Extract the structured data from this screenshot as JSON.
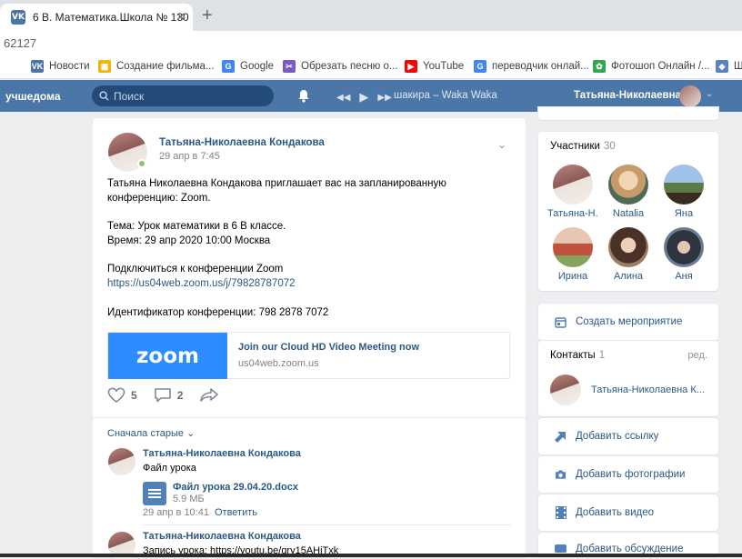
{
  "browser": {
    "tab_title": "6 В. Математика.Школа № 130",
    "tab_close": "✕",
    "new_tab": "+",
    "address": "62127",
    "bookmarks": [
      {
        "label": "Новости",
        "icon": "vk-icon",
        "color": "#4c75a3",
        "glyph": "VK"
      },
      {
        "label": "Создание фильма...",
        "icon": "colorful-grid-icon",
        "color": "#f4b400",
        "glyph": "▦"
      },
      {
        "label": "Google",
        "icon": "google-icon",
        "color": "#4285f4",
        "glyph": "G"
      },
      {
        "label": "Обрезать песню о...",
        "icon": "scissors-icon",
        "color": "#7b57c8",
        "glyph": "✂"
      },
      {
        "label": "YouTube",
        "icon": "youtube-icon",
        "color": "#ff0000",
        "glyph": "▶"
      },
      {
        "label": "переводчик онлай...",
        "icon": "google-icon",
        "color": "#4285f4",
        "glyph": "G"
      },
      {
        "label": "Фотошоп Онлайн /...",
        "icon": "photoshop-icon",
        "color": "#2fa84f",
        "glyph": "✿"
      },
      {
        "label": "Ш",
        "icon": "shield-icon",
        "color": "#5b7fc7",
        "glyph": "◆"
      }
    ]
  },
  "vk": {
    "brand": "учшедома",
    "search_placeholder": "Поиск",
    "track": "шакира – Waka Waka",
    "user_name": "Татьяна-Николаевна",
    "accent": "#4a76a8"
  },
  "post": {
    "author": "Татьяна-Николаевна Кондакова",
    "date": "29 апр в 7:45",
    "lines": [
      "Татьяна Николаевна Кондакова приглашает вас на запланированную",
      "конференцию: Zoom.",
      "Тема: Урок математики в 6 В классе.",
      "Время: 29 апр 2020 10:00 Москва",
      "Подключиться к конференции Zoom",
      "https://us04web.zoom.us/j/79828787072",
      "Идентификатор конференции: 798 2878 7072"
    ],
    "attachment": {
      "logo": "zoom",
      "title": "Join our Cloud HD Video Meeting now",
      "domain": "us04web.zoom.us"
    },
    "likes": "5",
    "comments": "2",
    "sort_label": "Сначала старые",
    "comment1": {
      "author": "Татьяна-Николаевна Кондакова",
      "text": "Файл урока",
      "doc_name": "Файл урока 29.04.20.docx",
      "doc_size": "5.9 МБ",
      "date": "29 апр в 10:41",
      "reply": "Ответить"
    },
    "comment2": {
      "author": "Татьяна-Николаевна Кондакова",
      "text": "Запись урока: https://youtu.be/qry15AHiTxk"
    }
  },
  "sidebar": {
    "members_title": "Участники",
    "members_count": "30",
    "members": [
      "Татьяна-Н...",
      "Natalia",
      "Яна",
      "Ирина",
      "Алина",
      "Аня"
    ],
    "create_event": "Создать мероприятие",
    "contacts_title": "Контакты",
    "contacts_count": "1",
    "contacts_edit": "ред.",
    "contact_name": "Татьяна-Николаевна К...",
    "add_link": "Добавить ссылку",
    "add_photos": "Добавить фотографии",
    "add_video": "Добавить видео",
    "add_discussion": "Добавить обсуждение"
  }
}
